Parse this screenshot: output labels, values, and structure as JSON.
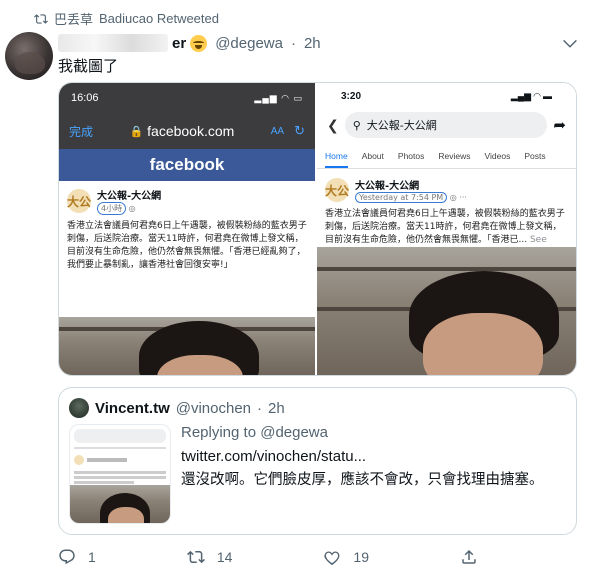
{
  "retweet_header": {
    "retweeter_name": "巴丢草",
    "retweeter_label": "Badiucao Retweeted"
  },
  "tweet": {
    "author_name_visible": "er",
    "author_handle": "@degewa",
    "time": "2h",
    "text": "我截圖了"
  },
  "screenshot_left": {
    "time": "16:06",
    "done_label": "完成",
    "url": "facebook.com",
    "aa_label": "AA",
    "brand": "facebook",
    "page_logo": "大公",
    "page_name": "大公報-大公網",
    "post_time": "4小時",
    "post_text": "香港立法會議員何君堯6日上午遇襲，被假裝粉絲的藍衣男子刺傷，后送院治療。當天11時許，何君堯在微博上發文稱，目前沒有生命危險，他仍然會無畏無懼。「香港已經亂夠了，我們要止暴制亂，讓香港社會回復安寧!」"
  },
  "screenshot_right": {
    "time": "3:20",
    "search_text": "大公報-大公網",
    "tabs": [
      "Home",
      "About",
      "Photos",
      "Reviews",
      "Videos",
      "Posts"
    ],
    "page_logo": "大公",
    "page_name": "大公報-大公網",
    "post_time": "Yesterday at 7:54 PM",
    "post_text": "香港立法會議員何君堯6日上午遇襲，被假裝粉絲的藍衣男子刺傷，后送院治療。當天11時許，何君堯在微博上發文稱，目前沒有生命危險，他仍然會無畏無懼。「香港已...",
    "see_more": "See more"
  },
  "quoted_tweet": {
    "author_name": "Vincent.tw",
    "author_handle": "@vinochen",
    "time": "2h",
    "replying_to": "Replying to @degewa",
    "link": "twitter.com/vinochen/statu...",
    "text": "還沒改啊。它們臉皮厚，應該不會改，只會找理由搪塞。"
  },
  "actions": {
    "replies": "1",
    "retweets": "14",
    "likes": "19"
  },
  "colors": {
    "facebook_blue": "#3b5998",
    "link_blue": "#1877f2",
    "muted": "#536471"
  }
}
